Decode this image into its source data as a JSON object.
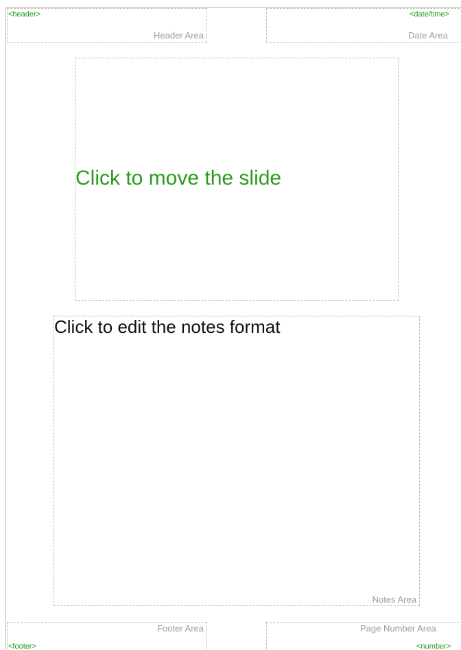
{
  "header": {
    "field_text": "<header>",
    "area_label": "Header Area"
  },
  "date": {
    "field_text": "<date/time>",
    "area_label": "Date Area"
  },
  "slide": {
    "text": "Click to move the slide"
  },
  "notes": {
    "text": "Click to edit the notes format",
    "area_label": "Notes Area"
  },
  "footer": {
    "field_text": "<footer>",
    "area_label": "Footer Area"
  },
  "page_number": {
    "field_text": "<number>",
    "area_label": "Page Number Area"
  },
  "colors": {
    "field_green": "#1a9c1a",
    "slide_green": "#2a9a1e",
    "area_label_gray": "#9a9a9a",
    "dashed_border": "#b9b9b9"
  }
}
